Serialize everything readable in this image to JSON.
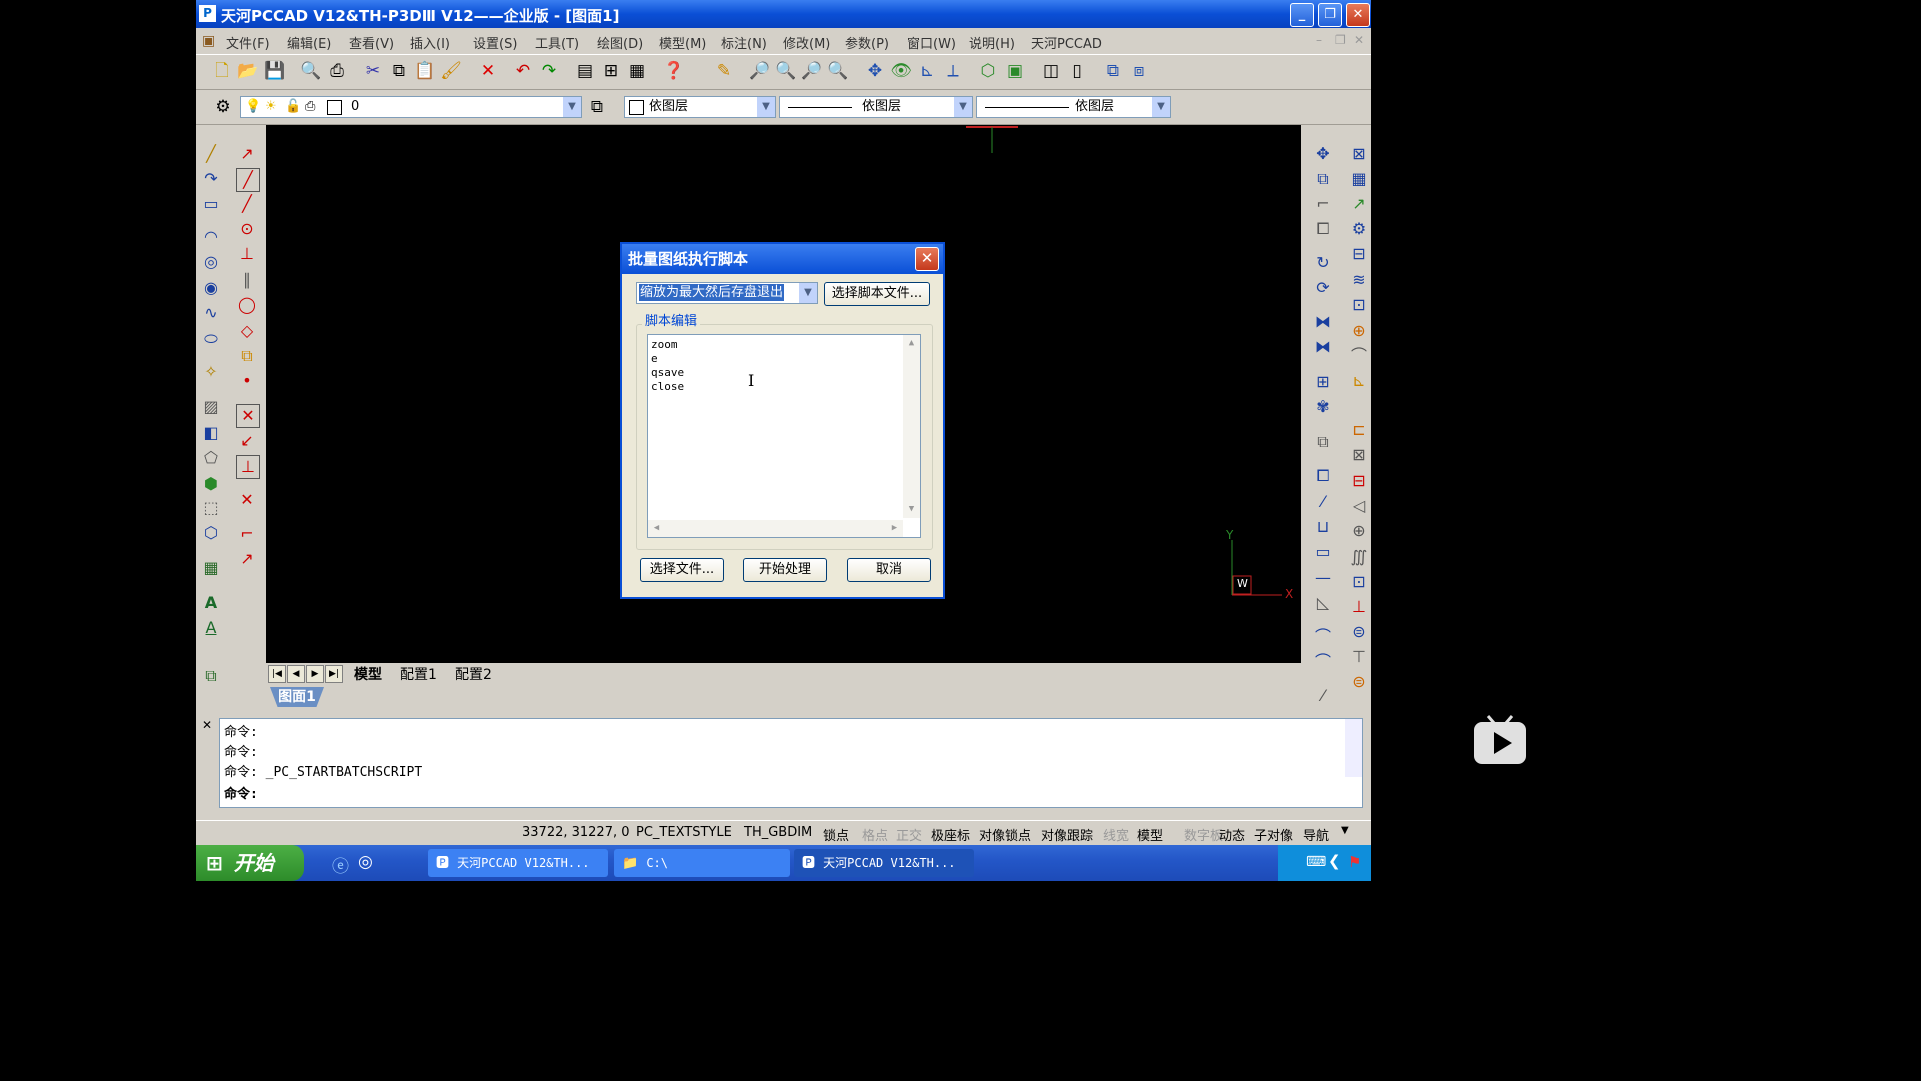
{
  "window": {
    "title": "天河PCCAD V12&TH-P3DⅢ V12——企业版 - [图面1]",
    "controls": {
      "minimize": "_",
      "restore": "❐",
      "close": "✕"
    }
  },
  "menu": {
    "items": [
      "文件(F)",
      "编辑(E)",
      "查看(V)",
      "插入(I)",
      "设置(S)",
      "工具(T)",
      "绘图(D)",
      "模型(M)",
      "标注(N)",
      "修改(M)",
      "参数(P)",
      "窗口(W)",
      "说明(H)",
      "天河PCCAD"
    ],
    "mdi_controls": [
      "–",
      "❐",
      "✕"
    ]
  },
  "toolbar2": {
    "layer_value": "0",
    "color_value": "依图层",
    "linetype_value": "依图层",
    "lineweight_value": "依图层"
  },
  "layout_tabs": [
    "模型",
    "配置1",
    "配置2"
  ],
  "drawing_tab": "图面1",
  "dialog": {
    "title": "批量图纸执行脚本",
    "script_select_value": "缩放为最大然后存盘退出",
    "choose_script_button": "选择脚本文件...",
    "group_label": "脚本编辑",
    "script_lines": [
      "zoom",
      "e",
      "qsave",
      "close"
    ],
    "choose_files_button": "选择文件...",
    "start_button": "开始处理",
    "cancel_button": "取消"
  },
  "command_lines": [
    "命令:",
    "命令:",
    "命令: _PC_STARTBATCHSCRIPT",
    "命令:"
  ],
  "status": {
    "coords": "33722, 31227, 0",
    "textstyle": "PC_TEXTSTYLE",
    "dimstyle": "TH_GBDIM",
    "toggles": [
      {
        "label": "锁点",
        "on": true
      },
      {
        "label": "格点",
        "on": false
      },
      {
        "label": "正交",
        "on": false
      },
      {
        "label": "极座标",
        "on": true
      },
      {
        "label": "对像锁点",
        "on": true
      },
      {
        "label": "对像跟踪",
        "on": true
      },
      {
        "label": "线宽",
        "on": false
      },
      {
        "label": "模型",
        "on": true
      },
      {
        "label": "数字板",
        "on": false
      },
      {
        "label": "动态",
        "on": true
      },
      {
        "label": "子对像",
        "on": true
      },
      {
        "label": "导航",
        "on": true
      }
    ]
  },
  "taskbar": {
    "start_label": "开始",
    "tasks": [
      "天河PCCAD V12&TH...",
      "C:\\",
      "天河PCCAD V12&TH..."
    ]
  },
  "ucs": {
    "x_label": "X",
    "y_label": "Y",
    "w_label": "W"
  },
  "colors": {
    "accent": "#0a4fd6",
    "canvas": "#000000",
    "chrome": "#d4d0c8"
  }
}
